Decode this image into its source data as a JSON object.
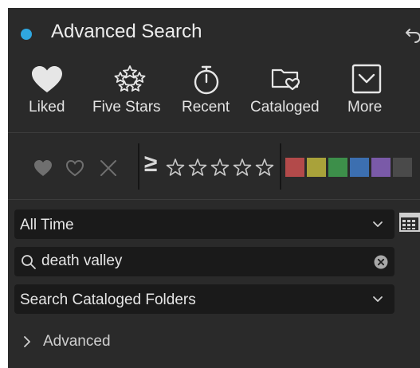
{
  "panel": {
    "title": "Advanced Search",
    "status_color": "#2fa7e0"
  },
  "quick_filters": [
    {
      "label": "Liked",
      "icon": "heart-icon"
    },
    {
      "label": "Five Stars",
      "icon": "five-stars-icon"
    },
    {
      "label": "Recent",
      "icon": "stopwatch-icon"
    },
    {
      "label": "Cataloged",
      "icon": "folder-heart-icon"
    },
    {
      "label": "More",
      "icon": "chevron-box-icon"
    }
  ],
  "rating_filter": {
    "comparison_symbol": "≥",
    "star_count": 5,
    "color_labels": [
      "#b34a4a",
      "#a9a23a",
      "#3d8f4a",
      "#3c6fb0",
      "#7a5aa8",
      "#4a4a4a"
    ]
  },
  "date_select": {
    "value": "All Time"
  },
  "search": {
    "value": "death valley"
  },
  "scope_select": {
    "value": "Search Cataloged Folders"
  },
  "advanced": {
    "label": "Advanced"
  }
}
